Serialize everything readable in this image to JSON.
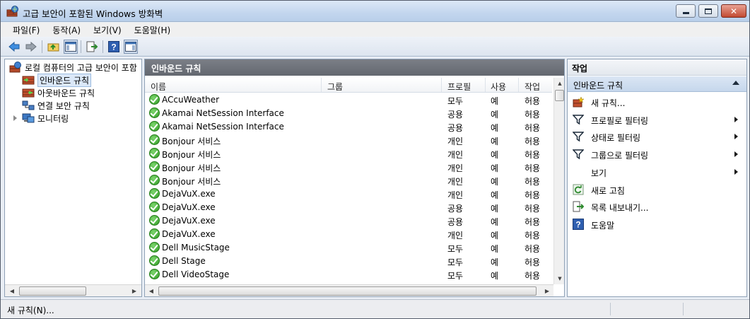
{
  "window": {
    "title": "고급 보안이 포함된 Windows 방화벽",
    "icon": "firewall-icon"
  },
  "menu": [
    "파일(F)",
    "동작(A)",
    "보기(V)",
    "도움말(H)"
  ],
  "tree": {
    "root": "로컬 컴퓨터의 고급 보안이 포함",
    "items": [
      {
        "label": "인바운드 규칙",
        "icon": "inbound-rules-icon",
        "selected": true
      },
      {
        "label": "아웃바운드 규칙",
        "icon": "outbound-rules-icon"
      },
      {
        "label": "연결 보안 규칙",
        "icon": "connection-security-icon"
      },
      {
        "label": "모니터링",
        "icon": "monitoring-icon"
      }
    ]
  },
  "list": {
    "header": "인바운드 규칙",
    "columns": [
      "이름",
      "그룹",
      "프로필",
      "사용",
      "작업"
    ],
    "rows": [
      {
        "name": "ACcuWeather",
        "group": "",
        "profile": "모두",
        "enabled": "예",
        "action": "허용"
      },
      {
        "name": "Akamai NetSession Interface",
        "group": "",
        "profile": "공용",
        "enabled": "예",
        "action": "허용"
      },
      {
        "name": "Akamai NetSession Interface",
        "group": "",
        "profile": "공용",
        "enabled": "예",
        "action": "허용"
      },
      {
        "name": "Bonjour 서비스",
        "group": "",
        "profile": "개인",
        "enabled": "예",
        "action": "허용"
      },
      {
        "name": "Bonjour 서비스",
        "group": "",
        "profile": "개인",
        "enabled": "예",
        "action": "허용"
      },
      {
        "name": "Bonjour 서비스",
        "group": "",
        "profile": "개인",
        "enabled": "예",
        "action": "허용"
      },
      {
        "name": "Bonjour 서비스",
        "group": "",
        "profile": "개인",
        "enabled": "예",
        "action": "허용"
      },
      {
        "name": "DejaVuX.exe",
        "group": "",
        "profile": "개인",
        "enabled": "예",
        "action": "허용"
      },
      {
        "name": "DejaVuX.exe",
        "group": "",
        "profile": "공용",
        "enabled": "예",
        "action": "허용"
      },
      {
        "name": "DejaVuX.exe",
        "group": "",
        "profile": "공용",
        "enabled": "예",
        "action": "허용"
      },
      {
        "name": "DejaVuX.exe",
        "group": "",
        "profile": "개인",
        "enabled": "예",
        "action": "허용"
      },
      {
        "name": "Dell MusicStage",
        "group": "",
        "profile": "모두",
        "enabled": "예",
        "action": "허용"
      },
      {
        "name": "Dell Stage",
        "group": "",
        "profile": "모두",
        "enabled": "예",
        "action": "허용"
      },
      {
        "name": "Dell VideoStage",
        "group": "",
        "profile": "모두",
        "enabled": "예",
        "action": "허용"
      }
    ]
  },
  "actions": {
    "title": "작업",
    "section": "인바운드 규칙",
    "items": [
      {
        "label": "새 규칙...",
        "icon": "new-rule-icon",
        "submenu": false
      },
      {
        "label": "프로필로 필터링",
        "icon": "filter-icon",
        "submenu": true
      },
      {
        "label": "상태로 필터링",
        "icon": "filter-icon",
        "submenu": true
      },
      {
        "label": "그룹으로 필터링",
        "icon": "filter-icon",
        "submenu": true
      },
      {
        "label": "보기",
        "icon": "",
        "submenu": true
      },
      {
        "label": "새로 고침",
        "icon": "refresh-icon",
        "submenu": false
      },
      {
        "label": "목록 내보내기...",
        "icon": "export-list-icon",
        "submenu": false
      },
      {
        "label": "도움말",
        "icon": "help-icon",
        "submenu": false
      }
    ]
  },
  "status": {
    "text": "새 규칙(N)..."
  }
}
